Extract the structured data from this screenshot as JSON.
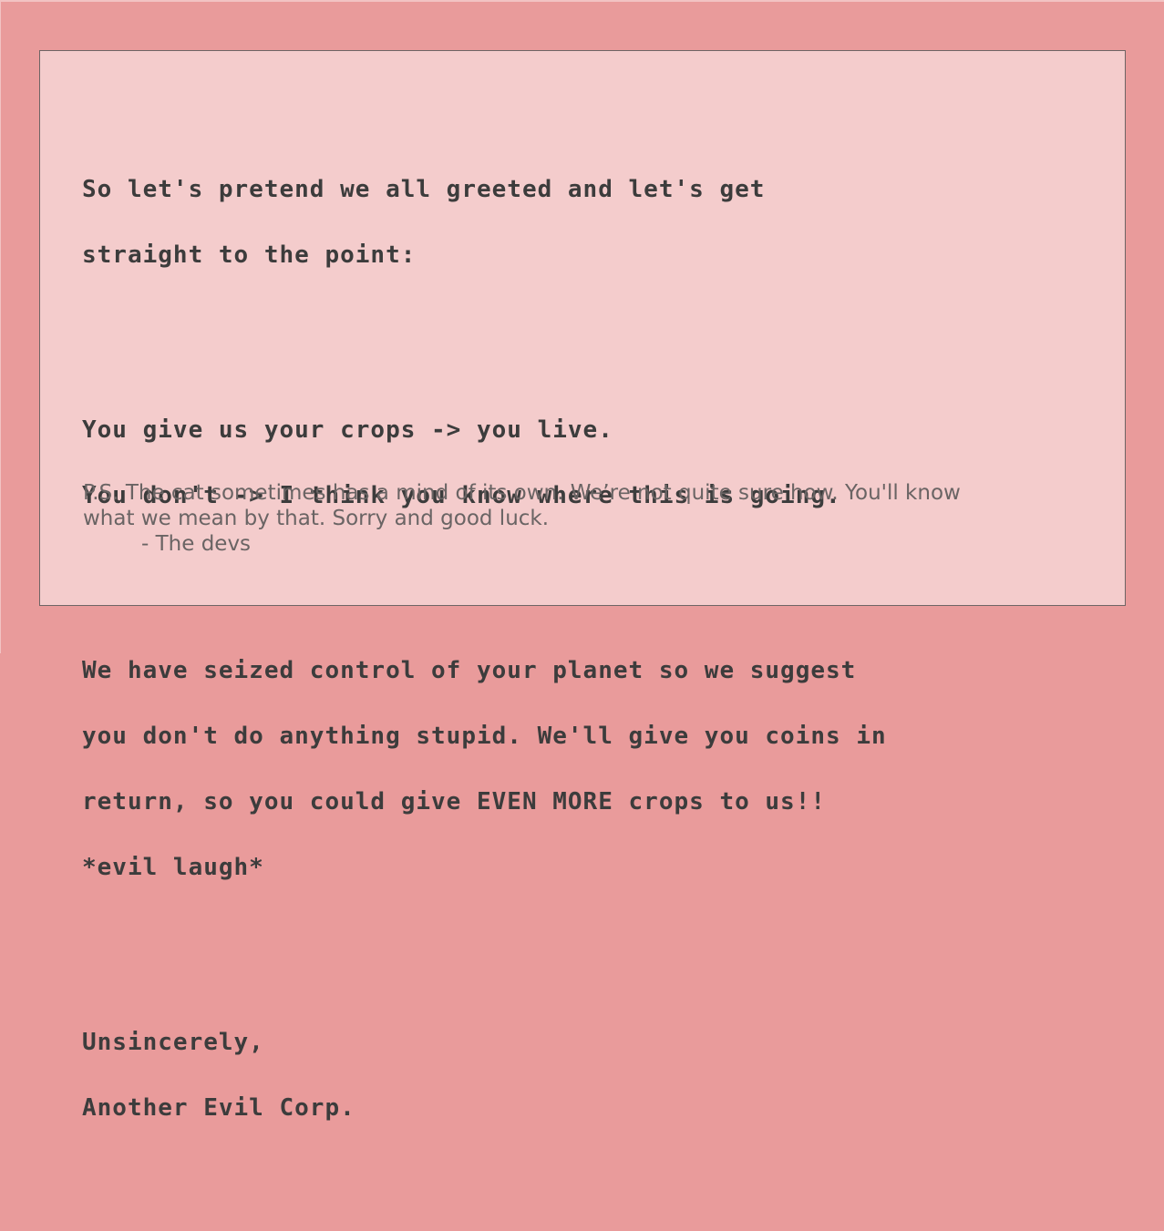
{
  "letter": {
    "paragraphs": [
      [
        "So let's pretend we all greeted and let's get",
        "straight to the point:"
      ],
      [
        "You give us your crops -> you live.",
        "You don't -> I think you know where this is going."
      ],
      [
        "We have seized control of your planet so we suggest",
        "you don't do anything stupid. We'll give you coins in",
        "return, so you could give EVEN MORE crops to us!!",
        "*evil laugh*"
      ],
      [
        "Unsincerely,",
        "Another Evil Corp."
      ]
    ],
    "postscript": {
      "lines": [
        "P.S. The cat sometimes has a mind of its own. We’re not quite sure how. You'll know",
        "what we mean by that. Sorry and good luck."
      ],
      "signature": "-  The devs"
    }
  },
  "colors": {
    "background": "#e99b9b",
    "paper": "#f4cccc",
    "text": "#3c3c3c",
    "postscript_text": "#6a6464",
    "border": "#6e6565"
  }
}
